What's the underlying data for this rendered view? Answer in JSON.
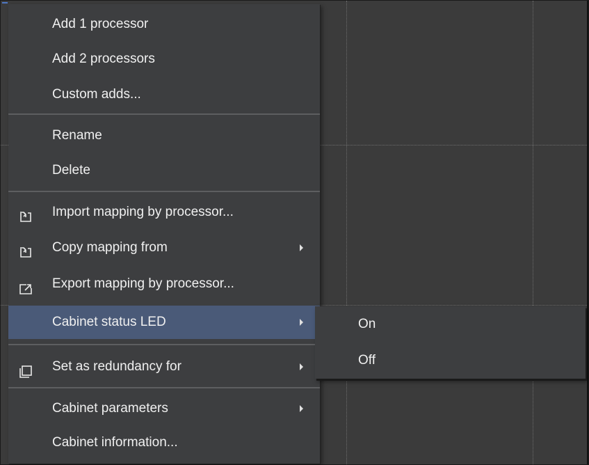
{
  "context_menu": {
    "items": [
      {
        "label": "Add 1 processor"
      },
      {
        "label": "Add 2 processors"
      },
      {
        "label": "Custom adds..."
      },
      {
        "label": "Rename"
      },
      {
        "label": "Delete"
      },
      {
        "label": "Import mapping by processor...",
        "icon": "import-icon"
      },
      {
        "label": "Copy mapping from",
        "icon": "import-icon",
        "has_submenu": true
      },
      {
        "label": "Export mapping by processor...",
        "icon": "export-icon"
      },
      {
        "label": "Cabinet status LED",
        "has_submenu": true,
        "highlighted": true
      },
      {
        "label": "Set as redundancy for",
        "icon": "redundancy-icon",
        "has_submenu": true
      },
      {
        "label": "Cabinet parameters",
        "has_submenu": true
      },
      {
        "label": "Cabinet information..."
      }
    ]
  },
  "submenu": {
    "parent": "Cabinet status LED",
    "items": [
      {
        "label": "On"
      },
      {
        "label": "Off"
      }
    ]
  },
  "colors": {
    "menu_background": "#3d3e40",
    "highlight": "#4a5a78",
    "canvas_background": "#3b3b3b",
    "text": "#f0f0f0"
  }
}
